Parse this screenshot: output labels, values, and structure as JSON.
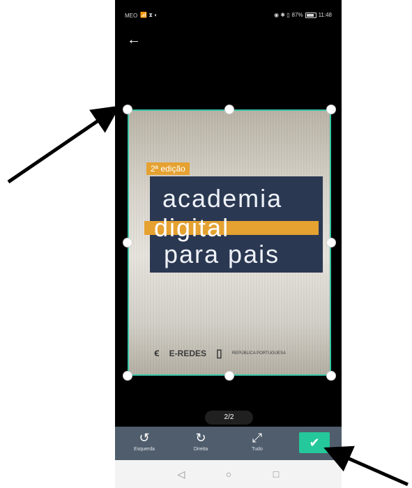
{
  "statusbar": {
    "carrier": "MEO",
    "left_icons": "📶 ⧗ ◐",
    "right_icons": "◉ ✱ ▯",
    "battery_percent": "87%",
    "time": "11:48"
  },
  "nav": {
    "back_icon": "back-arrow-icon"
  },
  "document": {
    "edition": "2ª edição",
    "title_line1": "academia",
    "title_line2": "digital",
    "title_line3": "para pais",
    "logo1": "E-REDES",
    "logo2": "REPÚBLICA PORTUGUESA"
  },
  "pager": {
    "label": "2/2"
  },
  "toolbar": {
    "rotate_left_label": "Esquerda",
    "rotate_right_label": "Direita",
    "all_label": "Tudo"
  },
  "colors": {
    "crop_border": "#39c6a7",
    "confirm": "#25c89a",
    "toolbar_bg": "#4f5d6c",
    "poster_bg": "#2b3852",
    "accent": "#e5a231"
  }
}
